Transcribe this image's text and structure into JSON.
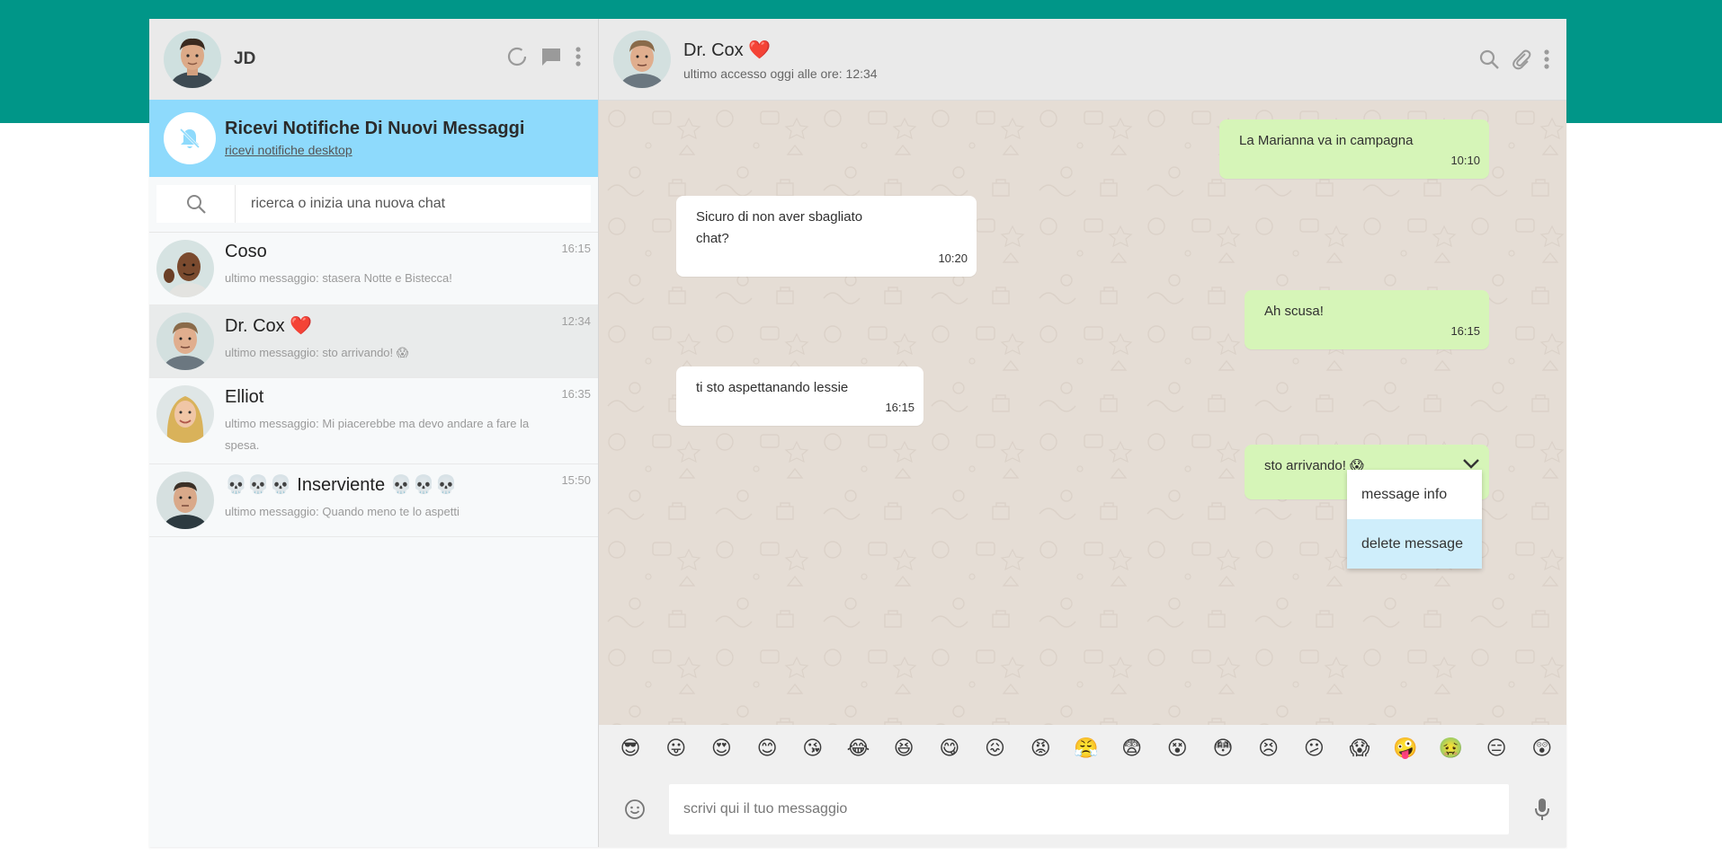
{
  "me": {
    "name": "JD",
    "avatar": "jd-avatar"
  },
  "left_icons": [
    "status-icon",
    "new-chat-icon",
    "menu-dots-icon"
  ],
  "notification": {
    "title": "Ricevi Notifiche Di Nuovi Messaggi",
    "link": "ricevi notifiche desktop",
    "icon": "bell-off-icon"
  },
  "search": {
    "placeholder": "ricerca o inizia una nuova chat",
    "icon": "search-icon"
  },
  "chats": [
    {
      "name": "Coso",
      "last": "ultimo messaggio: stasera Notte e Bistecca!",
      "time": "16:15",
      "avatar": "coso-avatar",
      "active": false
    },
    {
      "name": "Dr. Cox ❤️",
      "last": "ultimo messaggio: sto arrivando! 😱",
      "time": "12:34",
      "avatar": "drcox-avatar",
      "active": true
    },
    {
      "name": "Elliot",
      "last": "ultimo messaggio: Mi piacerebbe ma devo andare a fare la spesa.",
      "time": "16:35",
      "avatar": "elliot-avatar",
      "active": false
    },
    {
      "name": "💀💀💀 Inserviente 💀💀💀",
      "last": "ultimo messaggio: Quando meno te lo aspetti",
      "time": "15:50",
      "avatar": "inserviente-avatar",
      "active": false
    }
  ],
  "contact": {
    "name": "Dr. Cox",
    "heart": "❤️",
    "status": "ultimo accesso oggi alle ore: 12:34"
  },
  "right_icons": [
    "search-icon",
    "attach-icon",
    "menu-dots-icon"
  ],
  "messages": [
    {
      "type": "sent",
      "text": "La Marianna va in campagna",
      "time": "10:10"
    },
    {
      "type": "recv",
      "text": "Sicuro di non aver sbagliato chat?",
      "time": "10:20"
    },
    {
      "type": "sent",
      "text": "Ah scusa!",
      "time": "16:15"
    },
    {
      "type": "recv",
      "text": "ti sto aspettanando lessie",
      "time": "16:15"
    },
    {
      "type": "sent",
      "text": "sto arrivando! 😱",
      "time": "",
      "menu_open": true
    }
  ],
  "message_menu": {
    "items": [
      "message info",
      "delete message"
    ],
    "highlighted": "delete message"
  },
  "emojis": [
    "😎",
    "😛",
    "😍",
    "😊",
    "😘",
    "😂",
    "😆",
    "😋",
    "😖",
    "😡",
    "😤",
    "😨",
    "😵",
    "😳",
    "😣",
    "😕",
    "😱",
    "🤪",
    "🤢",
    "😑",
    "😲"
  ],
  "composer": {
    "placeholder": "scrivi qui il tuo messaggio",
    "emoji_icon": "smiley-icon",
    "mic_icon": "mic-icon"
  },
  "colors": {
    "top_band": "#009688",
    "notify_bg": "#8edafc",
    "sent_bubble": "#d6f5b8",
    "recv_bubble": "#ffffff",
    "chat_bg": "#e5ddd5",
    "menu_highlight": "#cfeefb"
  }
}
